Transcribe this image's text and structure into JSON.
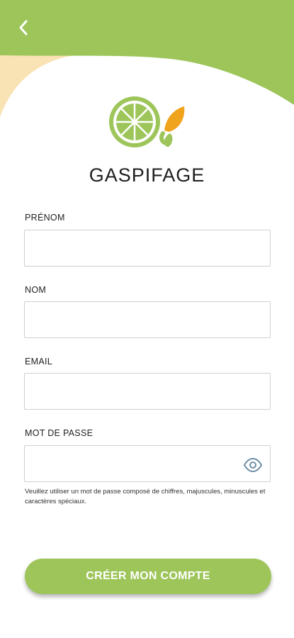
{
  "app": {
    "title": "GASPIFAGE"
  },
  "colors": {
    "accent_green": "#9dc55a",
    "accent_orange": "#f0a41e",
    "header_cream": "#f9e2b3"
  },
  "header": {
    "back_icon": "chevron-left-icon"
  },
  "form": {
    "first_name": {
      "label": "PRÉNOM",
      "value": "",
      "placeholder": ""
    },
    "last_name": {
      "label": "NOM",
      "value": "",
      "placeholder": ""
    },
    "email": {
      "label": "EMAIL",
      "value": "",
      "placeholder": ""
    },
    "password": {
      "label": "MOT DE PASSE",
      "value": "",
      "placeholder": "",
      "visibility_icon": "eye-icon",
      "hint": "Veuillez utiliser un mot de passe composé de chiffres, majuscules, minuscules et caractères spéciaux."
    },
    "submit_label": "CRÉER MON COMPTE"
  }
}
